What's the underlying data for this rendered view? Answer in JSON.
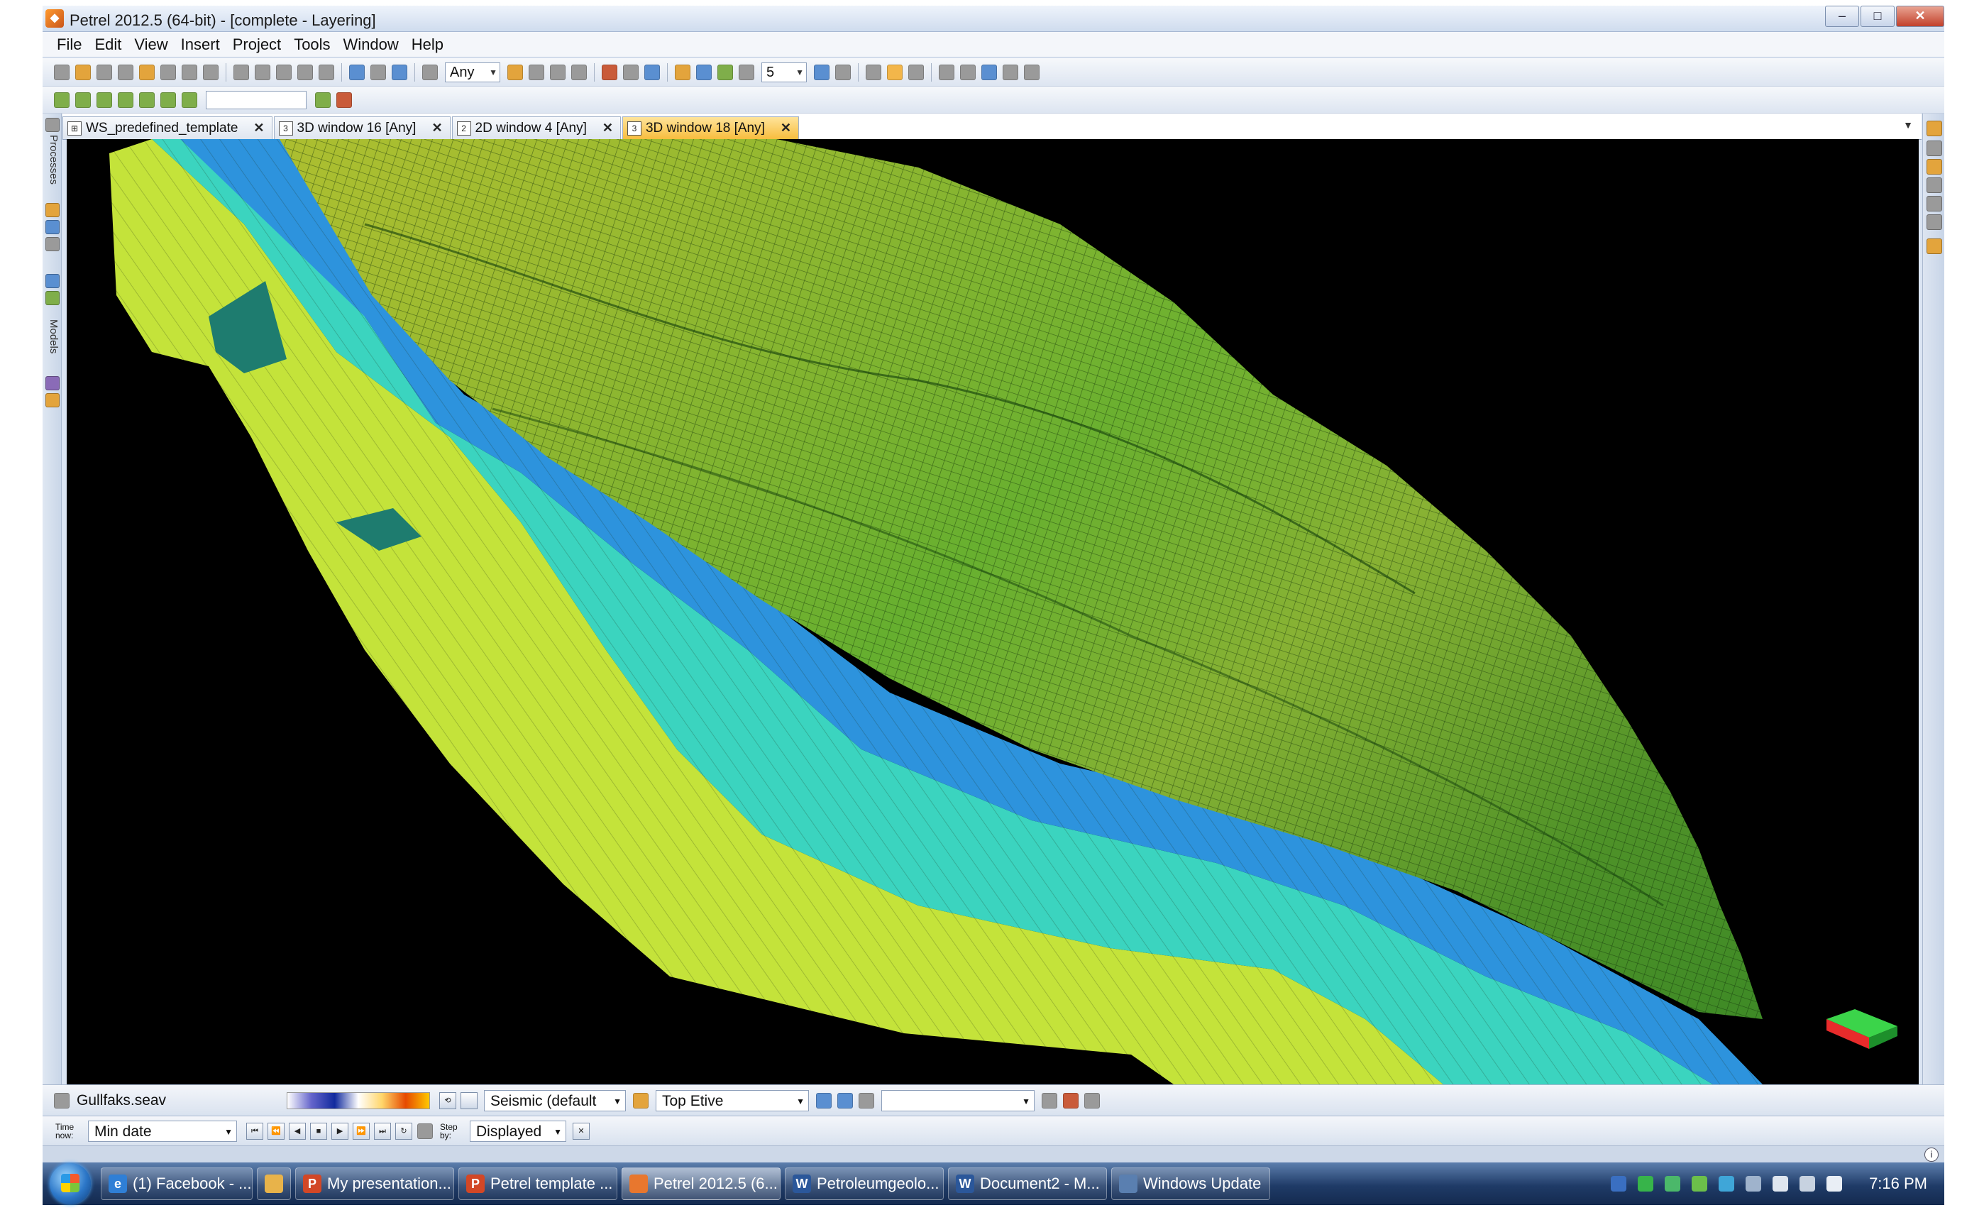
{
  "window": {
    "title": "Petrel 2012.5 (64-bit) - [complete - Layering]",
    "controls": {
      "minimize": "–",
      "maximize": "□",
      "close": "✕"
    }
  },
  "menu": [
    "File",
    "Edit",
    "View",
    "Insert",
    "Project",
    "Tools",
    "Window",
    "Help"
  ],
  "toolbar": {
    "filter_value": "Any",
    "step_value": "5"
  },
  "left_panel": {
    "processes_label": "Processes",
    "models_label": "Models"
  },
  "tabs": [
    {
      "icon": "⊞",
      "label": "WS_predefined_template",
      "close": "✕",
      "active": false
    },
    {
      "icon": "3",
      "label": "3D window 16 [Any]",
      "close": "✕",
      "active": false
    },
    {
      "icon": "2",
      "label": "2D window 4 [Any]",
      "close": "✕",
      "active": false
    },
    {
      "icon": "3",
      "label": "3D window 18 [Any]",
      "close": "✕",
      "active": true
    }
  ],
  "bottom": {
    "object_name": "Gullfaks.seav",
    "colortable": "Seismic (default",
    "surface": "Top Etive",
    "time_label": "Time now:",
    "time_value": "Min date",
    "step_label": "Step by:",
    "display_mode": "Displayed",
    "info_icon": "i"
  },
  "taskbar": {
    "items": [
      {
        "label": "(1) Facebook - ...",
        "icon_letter": "e",
        "color": "#2f7fd6"
      },
      {
        "label": "",
        "icon_letter": "",
        "color": "#e8b34a"
      },
      {
        "label": "My presentation...",
        "icon_letter": "P",
        "color": "#d24726"
      },
      {
        "label": "Petrel template ...",
        "icon_letter": "P",
        "color": "#d24726"
      },
      {
        "label": "Petrel 2012.5 (6...",
        "icon_letter": "",
        "color": "#e8772e"
      },
      {
        "label": "Petroleumgeolo...",
        "icon_letter": "W",
        "color": "#2b579a"
      },
      {
        "label": "Document2 - M...",
        "icon_letter": "W",
        "color": "#2b579a"
      },
      {
        "label": "Windows Update",
        "icon_letter": "",
        "color": "#5a7fb0"
      }
    ],
    "clock": "7:16 PM"
  },
  "colors": {
    "viewport_background": "#000000",
    "active_tab": "#f7bd3e",
    "surface_green": "#3fa52a",
    "layer_yellow": "#c6e63a",
    "layer_cyan": "#35d0c0",
    "layer_blue": "#2a8fd8"
  }
}
